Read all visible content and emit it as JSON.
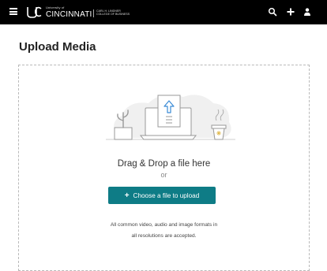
{
  "header": {
    "brand_small": "University of",
    "brand_name": "CINCINNATI",
    "brand_college_line1": "CARL H. LINDNER",
    "brand_college_line2": "COLLEGE OF BUSINESS",
    "background": "#000000"
  },
  "icons": {
    "menu": "hamburger-icon",
    "search": "search-icon",
    "add": "plus-icon",
    "account": "user-icon",
    "logo": "uc-logo-icon",
    "illustration": "upload-illustration"
  },
  "page": {
    "title": "Upload Media"
  },
  "dropzone": {
    "drag_text": "Drag & Drop a file here",
    "or_text": "or",
    "button_label": "Choose a file to upload",
    "button_color": "#0e7c86",
    "info_line1": "All common video, audio and image formats in",
    "info_line2": "all resolutions are accepted."
  }
}
